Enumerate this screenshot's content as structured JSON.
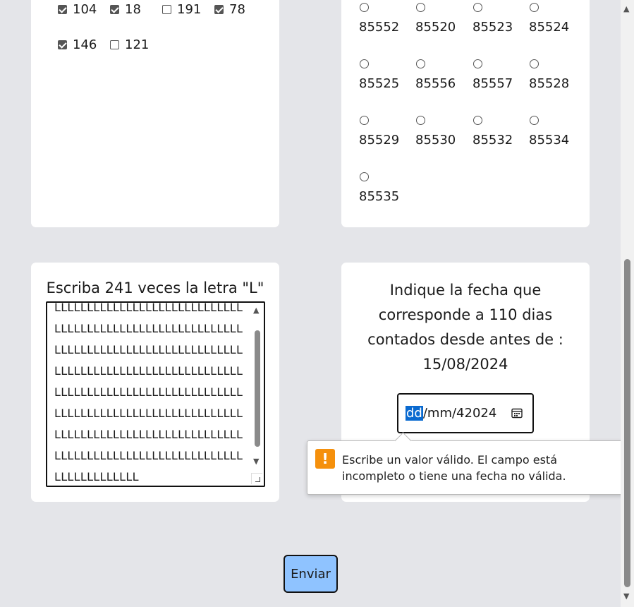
{
  "checkbox_card": {
    "items": [
      {
        "label": "104",
        "checked": true
      },
      {
        "label": "18",
        "checked": true
      },
      {
        "label": "191",
        "checked": false
      },
      {
        "label": "78",
        "checked": true
      },
      {
        "label": "146",
        "checked": true
      },
      {
        "label": "121",
        "checked": false
      }
    ]
  },
  "radio_card": {
    "options": [
      "85552",
      "85520",
      "85523",
      "85524",
      "85525",
      "85556",
      "85557",
      "85528",
      "85529",
      "85530",
      "85532",
      "85534",
      "85535"
    ]
  },
  "textarea_card": {
    "title": "Escriba 241 veces la letra \"L\"",
    "value": "LLLLLLLLLLLLLLLLLLLLLLLLLLLLLLLLLLLLLLLLLLLLLLLLLLLLLLLLLLLLLLLLLLLLLLLLLLLLLLLLLLLLLLLLLLLLLLLLLLLLLLLLLLLLLLLLLLLLLLLLLLLLLLLLLLLLLLLLLLLLLLLLLLLLLLLLLLLLLLLLLLLLLLLLLLLLLLLLLLLLLLLLLLLLLLLLLLLLLLLLLLLLLLLLLLLLLLLLLLLLLLLLLLLLLLLLLLLLLLLLLLLLL"
  },
  "date_card": {
    "question": "Indique la fecha que corresponde a 110 dias contados desde antes de : 15/08/2024",
    "date_dd": "dd",
    "date_rest": "/mm/42024",
    "calendar_icon": "calendar-icon"
  },
  "validation_tooltip": {
    "message": "Escribe un valor válido. El campo está incompleto o tiene una fecha no válida.",
    "icon": "!"
  },
  "submit": {
    "label": "Enviar"
  },
  "colors": {
    "background": "#e4e5e9",
    "button": "#8fc3ff",
    "selection": "#0a6ad0",
    "warning": "#f5900c"
  }
}
